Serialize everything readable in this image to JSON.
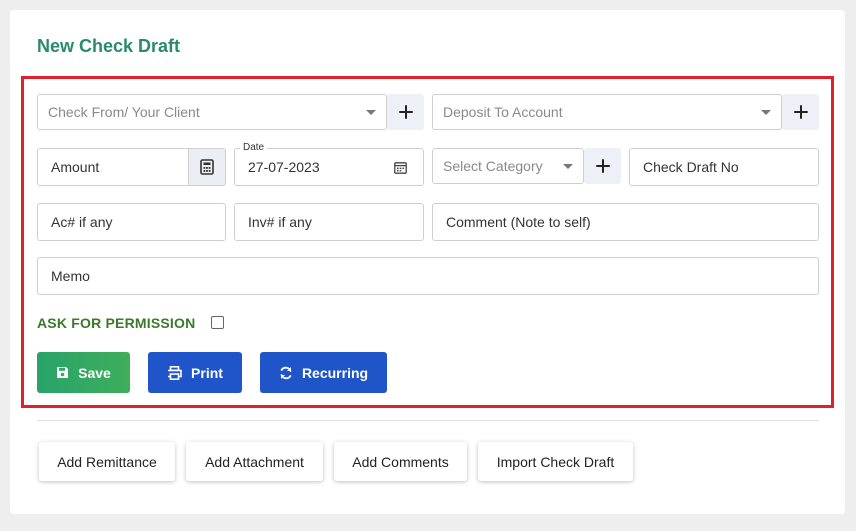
{
  "page": {
    "title": "New Check Draft"
  },
  "form": {
    "check_from_placeholder": "Check From/ Your Client",
    "deposit_to_placeholder": "Deposit To Account",
    "amount_placeholder": "Amount",
    "date_label": "Date",
    "date_value": "27-07-2023",
    "category_placeholder": "Select Category",
    "check_draft_no_placeholder": "Check Draft No",
    "account_placeholder": "Ac# if any",
    "invoice_placeholder": "Inv# if any",
    "comment_placeholder": "Comment (Note to self)",
    "memo_placeholder": "Memo",
    "ask_permission_label": "ASK FOR PERMISSION",
    "ask_permission_checked": false
  },
  "actions": {
    "save_label": "Save",
    "print_label": "Print",
    "recurring_label": "Recurring"
  },
  "secondary_actions": {
    "add_remittance": "Add Remittance",
    "add_attachment": "Add Attachment",
    "add_comments": "Add Comments",
    "import_check_draft": "Import Check Draft"
  },
  "icons": {
    "plus": "plus-icon",
    "calculator": "calculator-icon",
    "calendar": "calendar-icon",
    "save": "floppy-disk-icon",
    "print": "printer-icon",
    "recurring": "refresh-icon"
  },
  "colors": {
    "title": "#2a8a6e",
    "highlight": "#e0202a",
    "save": "#27a36b",
    "primary": "#1f55c9",
    "permission": "#3a7a2a"
  }
}
